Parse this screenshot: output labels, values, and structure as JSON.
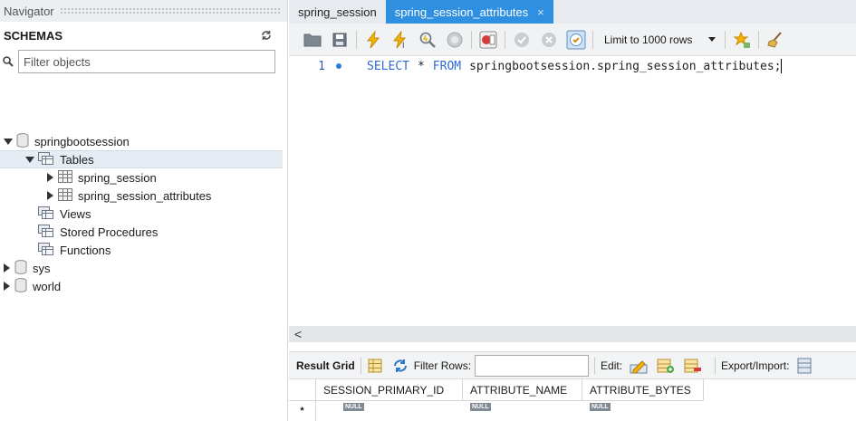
{
  "navigator": {
    "title": "Navigator",
    "schemas_label": "SCHEMAS",
    "filter_placeholder": "Filter objects",
    "tree": {
      "schema_main": "springbootsession",
      "tables": "Tables",
      "table_1": "spring_session",
      "table_2": "spring_session_attributes",
      "views": "Views",
      "procedures": "Stored Procedures",
      "functions": "Functions",
      "schema_sys": "sys",
      "schema_world": "world"
    }
  },
  "editor": {
    "tabs": [
      "spring_session",
      "spring_session_attributes"
    ],
    "tab_close": "×",
    "limit_label": "Limit to 1000 rows",
    "line_number": "1",
    "code": {
      "kw_select": "SELECT",
      "star": "*",
      "kw_from": "FROM",
      "object": "springbootsession.spring_session_attributes;"
    },
    "scroll_left": "<"
  },
  "results": {
    "result_grid_label": "Result Grid",
    "filter_rows_label": "Filter Rows:",
    "edit_label": "Edit:",
    "export_label": "Export/Import:",
    "columns": [
      "SESSION_PRIMARY_ID",
      "ATTRIBUTE_NAME",
      "ATTRIBUTE_BYTES"
    ],
    "row_marker": "*",
    "null_text": "NULL"
  }
}
